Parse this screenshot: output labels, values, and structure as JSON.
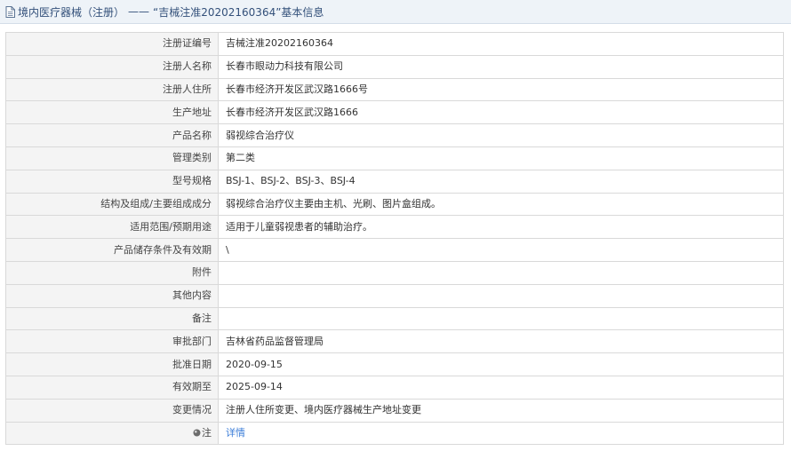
{
  "header": {
    "breadcrumb": "境内医疗器械（注册）",
    "separator": "——",
    "record_title": "“吉械注准20202160364”基本信息"
  },
  "rows": [
    {
      "label": "注册证编号",
      "value": "吉械注准20202160364"
    },
    {
      "label": "注册人名称",
      "value": "长春市眼动力科技有限公司"
    },
    {
      "label": "注册人住所",
      "value": "长春市经济开发区武汉路1666号"
    },
    {
      "label": "生产地址",
      "value": "长春市经济开发区武汉路1666"
    },
    {
      "label": "产品名称",
      "value": "弱视综合治疗仪"
    },
    {
      "label": "管理类别",
      "value": "第二类"
    },
    {
      "label": "型号规格",
      "value": "BSJ-1、BSJ-2、BSJ-3、BSJ-4"
    },
    {
      "label": "结构及组成/主要组成成分",
      "value": "弱视综合治疗仪主要由主机、光刷、图片盒组成。"
    },
    {
      "label": "适用范围/预期用途",
      "value": "适用于儿童弱视患者的辅助治疗。"
    },
    {
      "label": "产品储存条件及有效期",
      "value": "\\"
    },
    {
      "label": "附件",
      "value": ""
    },
    {
      "label": "其他内容",
      "value": ""
    },
    {
      "label": "备注",
      "value": ""
    },
    {
      "label": "审批部门",
      "value": "吉林省药品监督管理局"
    },
    {
      "label": "批准日期",
      "value": "2020-09-15"
    },
    {
      "label": "有效期至",
      "value": "2025-09-14"
    },
    {
      "label": "变更情况",
      "value": "注册人住所变更、境内医疗器械生产地址变更"
    }
  ],
  "note_row": {
    "label": "注",
    "link_text": "详情"
  },
  "icons": {
    "title_icon": "document-icon",
    "note_icon": "pin-icon"
  },
  "colors": {
    "title_text": "#33507a",
    "link": "#3b7dd8",
    "label_bg": "#f4f4f4",
    "title_bg": "#eef3f8"
  }
}
